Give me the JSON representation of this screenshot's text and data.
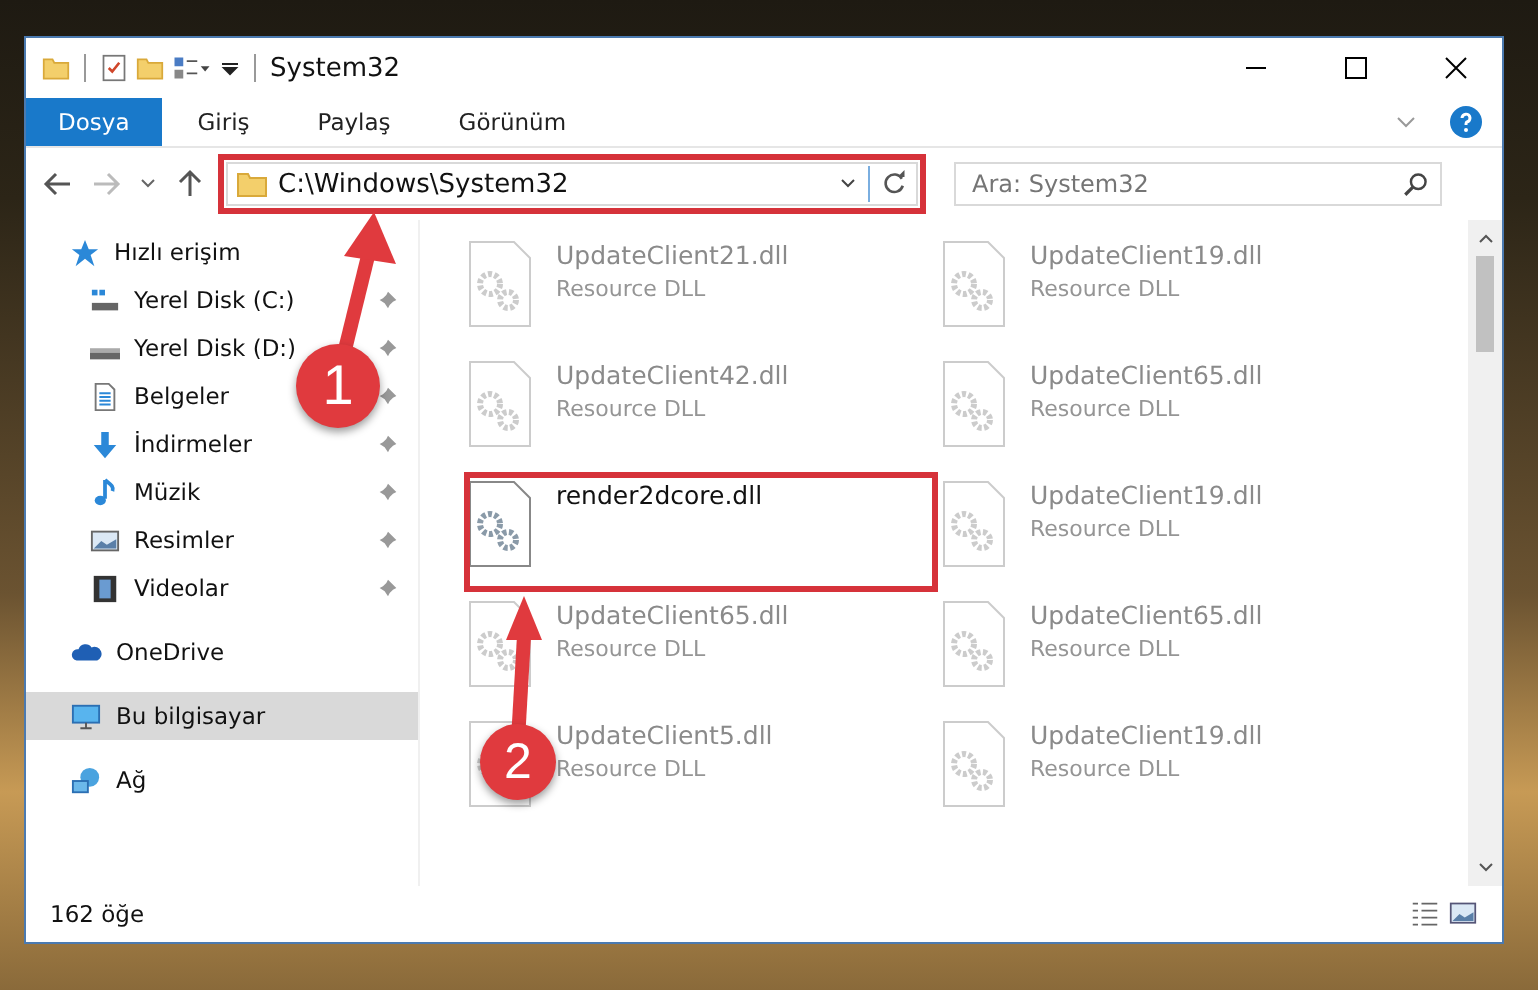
{
  "window": {
    "title": "System32"
  },
  "ribbon_tabs": [
    {
      "label": "Dosya",
      "selected": true
    },
    {
      "label": "Giriş",
      "selected": false
    },
    {
      "label": "Paylaş",
      "selected": false
    },
    {
      "label": "Görünüm",
      "selected": false
    }
  ],
  "address_bar": {
    "path": "C:\\Windows\\System32",
    "highlighted": true
  },
  "search": {
    "placeholder": "Ara: System32"
  },
  "sidebar": {
    "items": [
      {
        "label": "Hızlı erişim",
        "kind": "star",
        "selected": false,
        "children": [
          {
            "label": "Yerel Disk (C:)",
            "kind": "drive-c",
            "pinned": true,
            "selected": false
          },
          {
            "label": "Yerel Disk (D:)",
            "kind": "drive",
            "pinned": true,
            "selected": false
          },
          {
            "label": "Belgeler",
            "kind": "doc",
            "pinned": true,
            "selected": false
          },
          {
            "label": "İndirmeler",
            "kind": "download",
            "pinned": true,
            "selected": false
          },
          {
            "label": "Müzik",
            "kind": "music",
            "pinned": true,
            "selected": false
          },
          {
            "label": "Resimler",
            "kind": "pictures",
            "pinned": true,
            "selected": false
          },
          {
            "label": "Videolar",
            "kind": "video",
            "pinned": true,
            "selected": false
          }
        ]
      },
      {
        "label": "OneDrive",
        "kind": "cloud",
        "selected": false
      },
      {
        "label": "Bu bilgisayar",
        "kind": "pc",
        "selected": true
      },
      {
        "label": "Ağ",
        "kind": "network",
        "selected": false
      }
    ]
  },
  "files": [
    {
      "name": "UpdateClient21.dll",
      "type": "Resource DLL",
      "blurred": true
    },
    {
      "name": "UpdateClient19.dll",
      "type": "Resource DLL",
      "blurred": true
    },
    {
      "name": "UpdateClient42.dll",
      "type": "Resource DLL",
      "blurred": true
    },
    {
      "name": "UpdateClient65.dll",
      "type": "Resource DLL",
      "blurred": true
    },
    {
      "name": "render2dcore.dll",
      "blurred": false,
      "highlighted": true
    },
    {
      "name": "UpdateClient19.dll",
      "type": "Resource DLL",
      "blurred": true
    },
    {
      "name": "UpdateClient65.dll",
      "type": "Resource DLL",
      "blurred": true
    },
    {
      "name": "UpdateClient65.dll",
      "type": "Resource DLL",
      "blurred": true
    },
    {
      "name": "UpdateClient5.dll",
      "type": "Resource DLL",
      "blurred": true
    },
    {
      "name": "UpdateClient19.dll",
      "type": "Resource DLL",
      "blurred": true
    }
  ],
  "status_bar": {
    "item_count": "162 öğe"
  },
  "annotations": [
    {
      "number": "1"
    },
    {
      "number": "2"
    }
  ]
}
